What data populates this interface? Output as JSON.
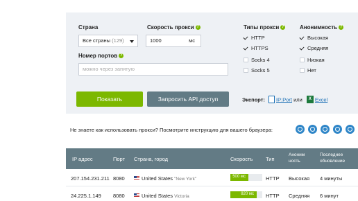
{
  "filters": {
    "country": {
      "label": "Страна",
      "value": "Все страны",
      "count": "(129)"
    },
    "speed": {
      "label": "Скорость прокси",
      "value": "1000",
      "unit": "мс"
    },
    "ports": {
      "label": "Номер портов",
      "placeholder": "можно через запятую"
    },
    "proxy_types": {
      "label": "Типы прокси",
      "items": [
        {
          "label": "HTTP",
          "checked": true
        },
        {
          "label": "HTTPS",
          "checked": true
        },
        {
          "label": "Socks 4",
          "checked": false
        },
        {
          "label": "Socks 5",
          "checked": false
        }
      ]
    },
    "anonymity": {
      "label": "Анонимность",
      "items": [
        {
          "label": "Высокая",
          "checked": true
        },
        {
          "label": "Средняя",
          "checked": true
        },
        {
          "label": "Низкая",
          "checked": false
        },
        {
          "label": "Нет",
          "checked": false
        }
      ]
    },
    "help_glyph": "?"
  },
  "actions": {
    "show": "Показать",
    "api": "Запросить API доступ"
  },
  "export": {
    "label": "Экспорт:",
    "ipport": "IP:Port",
    "or": "или",
    "excel": "Excel",
    "excel_glyph": "X"
  },
  "instructions": "Не знаете как использовать прокси? Посмотрите инструкцию для вашего браузера:",
  "browsers": [
    "opera-icon",
    "chrome-icon",
    "firefox-icon",
    "safari-icon",
    "ie-icon"
  ],
  "table": {
    "headers": {
      "ip": "IP адрес",
      "port": "Порт",
      "country": "Страна, город",
      "speed": "Скорость",
      "type": "Тип",
      "anon_1": "Аноним",
      "anon_2": "ность",
      "updated_1": "Последнее",
      "updated_2": "обновление"
    },
    "rows": [
      {
        "ip": "207.154.231.211",
        "port": "8080",
        "country": "United States",
        "city": "\"New York\"",
        "speed": "500 мс",
        "speed_ms": 500,
        "type": "HTTP",
        "anonymity": "Высокая",
        "updated": "4 минуты"
      },
      {
        "ip": "24.225.1.149",
        "port": "8080",
        "country": "United States",
        "city": "Victoria",
        "speed": "820 мс",
        "speed_ms": 820,
        "type": "HTTP",
        "anonymity": "Средняя",
        "updated": "6 минут"
      }
    ]
  },
  "colors": {
    "accent": "#7cb800",
    "secondary": "#627b85",
    "panel": "#eef1f5",
    "link": "#1a6fb5"
  }
}
